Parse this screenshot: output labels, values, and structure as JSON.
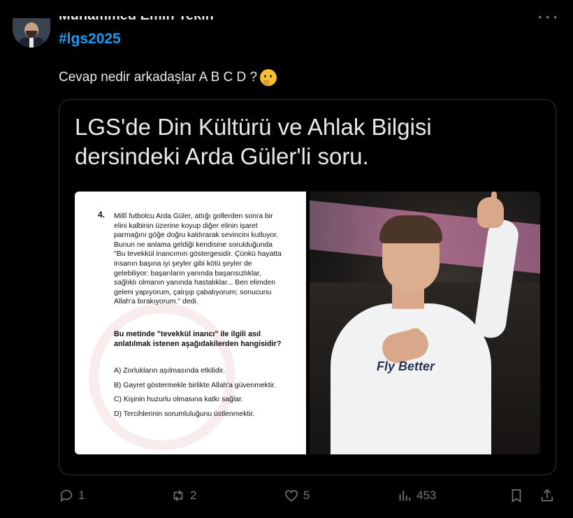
{
  "author": {
    "name": "Muhammed Emin Tekin",
    "hashtag": "#lgs2025"
  },
  "tweet": {
    "text": "Cevap nedir arkadaşlar A B C D ?"
  },
  "card": {
    "headline": "LGS'de Din Kültürü ve Ahlak Bilgisi dersindeki Arda Güler'li soru.",
    "question": {
      "number": "4.",
      "body": "Millî futbolcu Arda Güler, attığı gollerden sonra bir elini kalbinin üzerine koyup diğer elinin işaret parmağını göğe doğru kaldırarak sevincini kutluyor. Bunun ne anlama geldiği kendisine sorulduğunda \"Bu tevekkül inancımın göstergesidir. Çünkü hayatta insanın başına iyi şeyler gibi kötü şeyler de gelebiliyor: başarıların yanında başarısızlıklar, sağlıklı olmanın yanında hastalıklar... Ben elimden geleni yapıyorum, çalışıp çabalıyorum; sonucunu Allah'a bırakıyorum.\" dedi.",
      "prompt": "Bu metinde \"tevekkül inancı\" ile ilgili asıl anlatılmak istenen aşağıdakilerden hangisidir?",
      "options": [
        "A) Zorlukların aşılmasında etkilidir.",
        "B) Gayret göstermekle birlikte Allah'a güvenmektir.",
        "C) Kişinin huzurlu olmasına katkı sağlar.",
        "D) Tercihlerinin sorumluluğunu üstlenmektir."
      ]
    },
    "photo": {
      "jersey_text": "Fly Better"
    }
  },
  "actions": {
    "replies": "1",
    "reposts": "2",
    "likes": "5",
    "views": "453"
  },
  "colors": {
    "background": "#000000",
    "text": "#e7e9ea",
    "muted": "#71767b",
    "accent": "#1d9bf0",
    "border": "#2f3336"
  }
}
